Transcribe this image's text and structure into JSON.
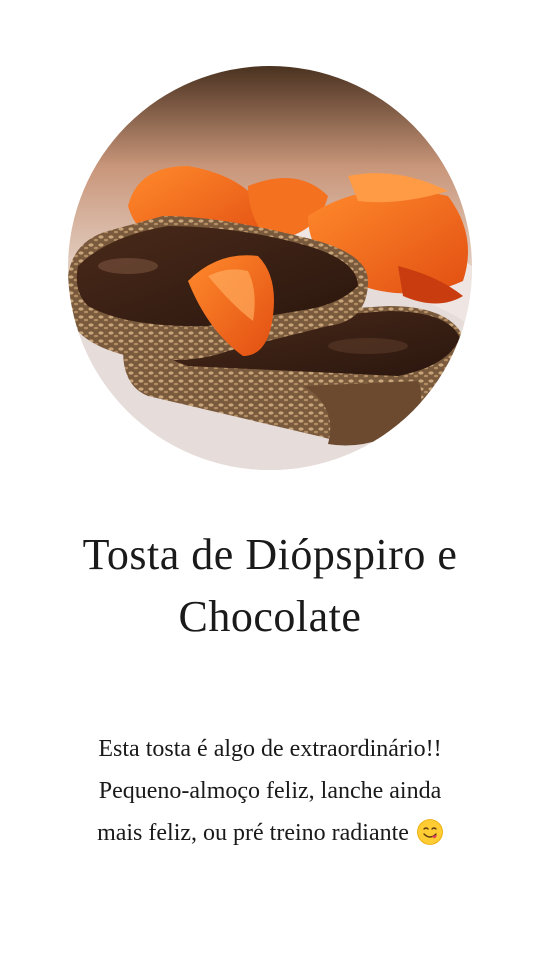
{
  "post": {
    "photo_icon": "toast-photo-icon",
    "title_lines": [
      "Tosta de Diópspiro e",
      "Chocolate"
    ],
    "description_lines": [
      "Esta tosta é algo de extraordinário!!",
      "Pequeno-almoço feliz, lanche ainda",
      "mais feliz, ou pré treino radiante"
    ],
    "emoji_icon": "yum-face-emoji-icon"
  },
  "colors": {
    "background": "#ffffff",
    "text": "#1a1a1a",
    "persimmon": "#f07a2a",
    "chocolate": "#3a2318",
    "bread": "#8a6540"
  }
}
